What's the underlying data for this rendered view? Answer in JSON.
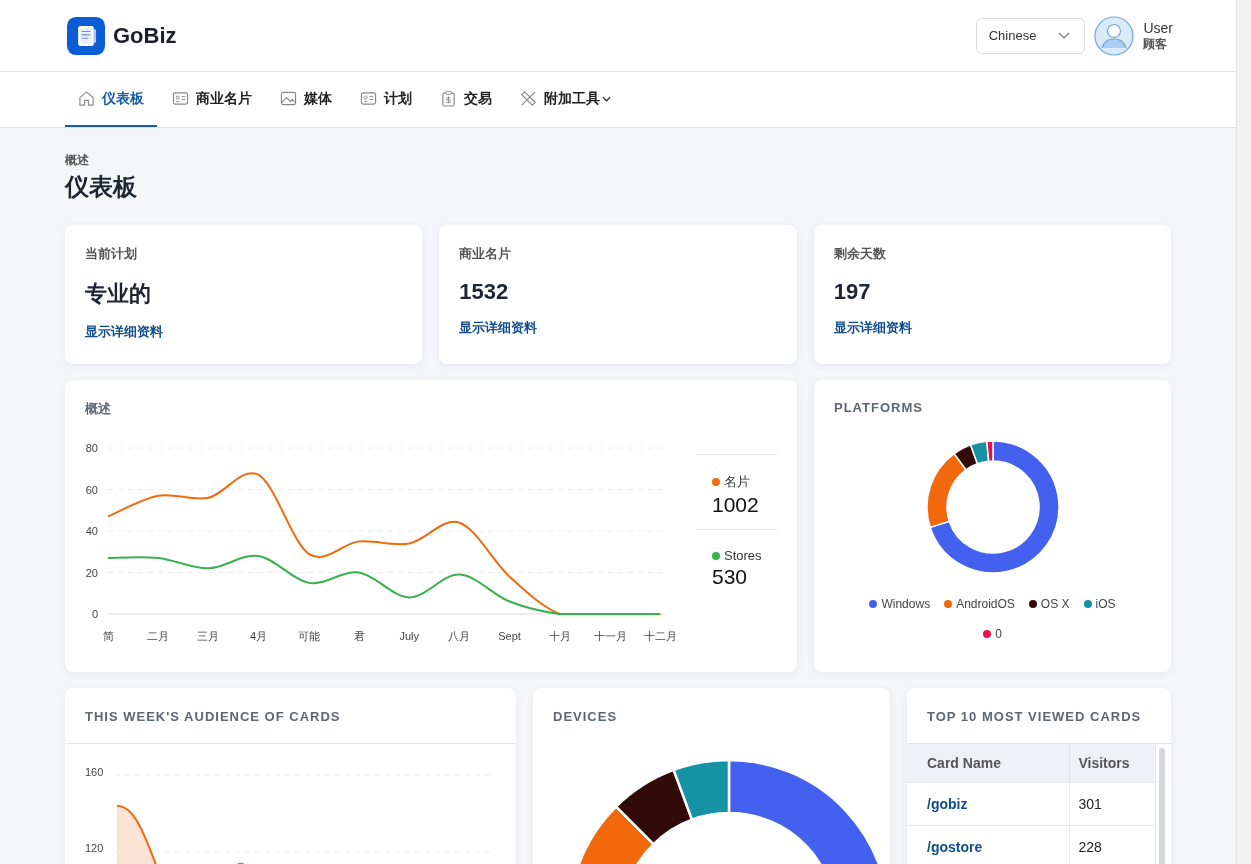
{
  "header": {
    "logo_text": "GoBiz",
    "language": "Chinese",
    "user_name": "User",
    "user_role": "顾客"
  },
  "nav": [
    {
      "label": "仪表板",
      "kind": "home",
      "selected": true,
      "has_menu": false
    },
    {
      "label": "商业名片",
      "kind": "card",
      "selected": false,
      "has_menu": false
    },
    {
      "label": "媒体",
      "kind": "image",
      "selected": false,
      "has_menu": false
    },
    {
      "label": "计划",
      "kind": "card",
      "selected": false,
      "has_menu": false
    },
    {
      "label": "交易",
      "kind": "clipboard",
      "selected": false,
      "has_menu": false
    },
    {
      "label": "附加工具",
      "kind": "tools",
      "selected": false,
      "has_menu": true
    }
  ],
  "page": {
    "breadcrumb": "概述",
    "title": "仪表板"
  },
  "stats": [
    {
      "label": "当前计划",
      "value": "专业的",
      "link": "显示详细资料"
    },
    {
      "label": "商业名片",
      "value": "1532",
      "link": "显示详细资料"
    },
    {
      "label": "剩余天数",
      "value": "197",
      "link": "显示详细资料"
    }
  ],
  "overview": {
    "title": "概述",
    "chart_data": {
      "type": "line",
      "categories": [
        "简",
        "二月",
        "三月",
        "4月",
        "可能",
        "君",
        "July",
        "八月",
        "Sept",
        "十月",
        "十一月",
        "十二月"
      ],
      "series": [
        {
          "name": "名片",
          "color": "#f06a0f",
          "values": [
            47,
            57,
            56,
            67,
            29,
            35,
            34,
            44,
            18,
            0,
            0,
            0
          ]
        },
        {
          "name": "Stores",
          "color": "#37b24d",
          "values": [
            27,
            27,
            22,
            28,
            15,
            20,
            8,
            19,
            6,
            0,
            0,
            0
          ]
        }
      ],
      "ylim": [
        0,
        80
      ],
      "yticks": [
        0,
        20,
        40,
        60,
        80
      ],
      "grid": true
    },
    "totals": [
      "1002",
      "530"
    ]
  },
  "platforms": {
    "title": "PLATFORMS",
    "chart_data": {
      "type": "donut",
      "categories": [
        "Windows",
        "AndroidOS",
        "OS X",
        "iOS",
        "0"
      ],
      "values": [
        70,
        20,
        4.5,
        4,
        1.5
      ],
      "colors": [
        "#4361ee",
        "#f2690d",
        "#330a0a",
        "#1593a5",
        "#e8104a"
      ]
    }
  },
  "audience": {
    "title": "THIS WEEK'S AUDIENCE OF CARDS",
    "y_labels": [
      "160",
      "120"
    ]
  },
  "devices": {
    "title": "DEVICES"
  },
  "top_cards": {
    "title": "TOP 10 MOST VIEWED CARDS",
    "columns": [
      "Card Name",
      "Visitors"
    ],
    "rows": [
      [
        "/gobiz",
        "301"
      ],
      [
        "/gostore",
        "228"
      ]
    ]
  }
}
